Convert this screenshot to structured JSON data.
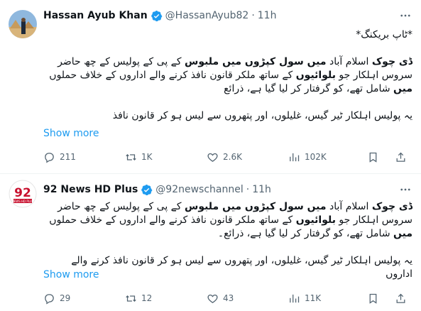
{
  "tweets": [
    {
      "author_name": "Hassan Ayub Khan",
      "handle": "@HassanAyub82",
      "separator": "·",
      "time": "11h",
      "body": {
        "line1": "*ٹاپ بریکنگ*",
        "p2_bold1": "ڈی چوک",
        "p2_text1": "  اسلام آباد ",
        "p2_bold2": "میں سول کپڑوں میں ملبوس",
        "p2_text2": " کے پی کے پولیس کے چھ حاضر سروس اہلکار جو ",
        "p2_bold3": "بلوائیوں",
        "p2_text3": " کے ساتھ ملکر قانون نافذ کرنے والے اداروں کے خلاف حملوں ",
        "p2_bold4": "میں",
        "p2_text4": " شامل تھے، کو گرفتار کر لیا گیا ہے، ذرائع",
        "line3": "یہ پولیس اہلکار ٹیر گیس، غلیلوں، اور پتھروں سے لیس ہو کر قانون نافذ"
      },
      "show_more": "Show more",
      "actions": {
        "replies": "211",
        "reposts": "1K",
        "likes": "2.6K",
        "views": "102K"
      }
    },
    {
      "author_name": "92 News HD Plus",
      "handle": "@92newschannel",
      "separator": "·",
      "time": "11h",
      "avatar_text": "92",
      "avatar_sub": "NEWS HD PLUS",
      "body": {
        "p1_bold1": "ڈی چوک",
        "p1_text1": " اسلام آباد ",
        "p1_bold2": "میں سول کپڑوں میں ملبوس",
        "p1_text2": " کے پی کے پولیس کے چھ حاضر سروس اہلکار جو ",
        "p1_bold3": "بلوائیوں",
        "p1_text3": " کے ساتھ ملکر قانون نافذ کرنے والے اداروں کے خلاف حملوں ",
        "p1_bold4": "میں",
        "p1_text4": " شامل تھے، کو گرفتار کر لیا گیا ہے، ذرائع۔",
        "line2": "یہ پولیس اہلکار ٹیر گیس، غلیلوں، اور پتھروں سے لیس ہو کر قانون نافذ کرنے والے اداروں"
      },
      "show_more": "Show more",
      "actions": {
        "replies": "29",
        "reposts": "12",
        "likes": "43",
        "views": "11K"
      }
    }
  ],
  "colors": {
    "link": "#1d9bf0",
    "muted": "#536471",
    "verified": "#1d9bf0",
    "text": "#0f1419"
  },
  "icons": [
    "verified-badge-icon",
    "more-icon",
    "reply-icon",
    "repost-icon",
    "like-icon",
    "views-icon",
    "bookmark-icon",
    "share-icon"
  ]
}
